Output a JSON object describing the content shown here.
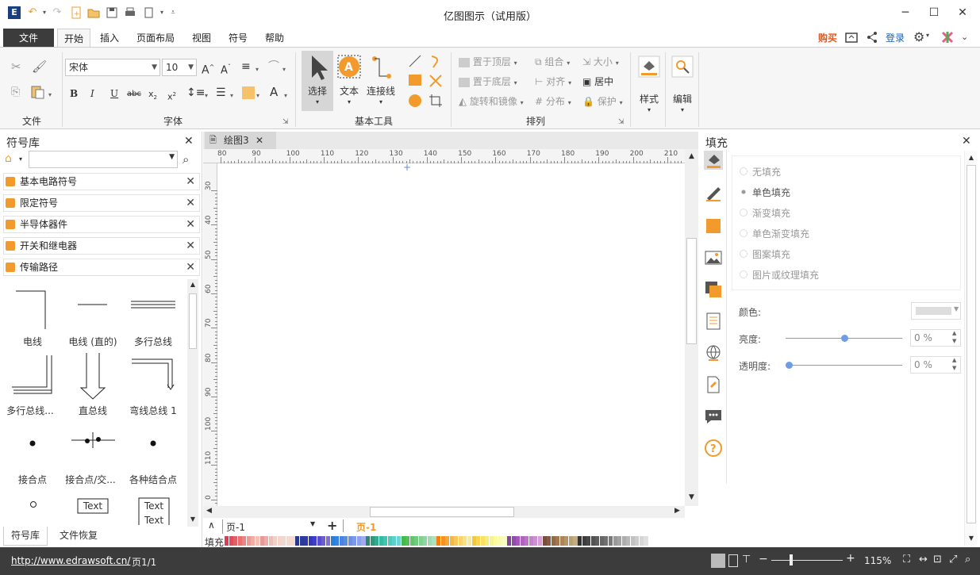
{
  "title": "亿图图示（试用版）",
  "menu": {
    "file": "文件",
    "home": "开始",
    "insert": "插入",
    "page_layout": "页面布局",
    "view": "视图",
    "symbol": "符号",
    "help": "帮助"
  },
  "account": {
    "buy": "购买",
    "login": "登录"
  },
  "ribbon": {
    "groups": {
      "file": "文件",
      "font": "字体",
      "basic_tools": "基本工具",
      "arrange": "排列"
    },
    "font_name": "宋体",
    "font_size": "10",
    "select": "选择",
    "text": "文本",
    "connector": "连接线",
    "bring_front": "置于顶层",
    "send_back": "置于底层",
    "rotate_mirror": "旋转和镜像",
    "group": "组合",
    "align": "对齐",
    "distribute": "分布",
    "size": "大小",
    "center": "居中",
    "protect": "保护",
    "style": "样式",
    "edit": "编辑"
  },
  "library": {
    "title": "符号库",
    "categories": [
      "基本电路符号",
      "限定符号",
      "半导体器件",
      "开关和继电器",
      "传输路径"
    ],
    "symbols": [
      "电线",
      "电线 (直的)",
      "多行总线",
      "多行总线...",
      "直总线",
      "弯线总线 1",
      "接合点",
      "接合点/交...",
      "各种结合点"
    ],
    "text_sample": "Text",
    "bottom_tabs": [
      "符号库",
      "文件恢复"
    ]
  },
  "document": {
    "tab": "绘图3",
    "page_select": "页-1",
    "page_tab": "页-1",
    "fill_label": "填充"
  },
  "ruler": {
    "h_ticks": [
      "80",
      "90",
      "100",
      "110",
      "120",
      "130",
      "140",
      "150",
      "160",
      "170",
      "180",
      "190",
      "200",
      "210"
    ],
    "v_ticks": [
      "30",
      "40",
      "50",
      "60",
      "70",
      "80",
      "90",
      "100",
      "110",
      "0"
    ]
  },
  "fill_panel": {
    "title": "填充",
    "options": [
      "无填充",
      "单色填充",
      "渐变填充",
      "单色渐变填充",
      "图案填充",
      "图片或纹理填充"
    ],
    "color_label": "颜色:",
    "brightness_label": "亮度:",
    "transparency_label": "透明度:",
    "brightness_value": "0 %",
    "transparency_value": "0 %",
    "brightness_level": 0.5,
    "transparency_level": 0
  },
  "status": {
    "url": "http://www.edrawsoft.cn/",
    "page": "页1/1",
    "zoom": "115%"
  },
  "colors": {
    "accent": "#f29b2c",
    "dark": "#3c3c3c",
    "buy": "#e8561c",
    "link": "#1a5fb4"
  }
}
